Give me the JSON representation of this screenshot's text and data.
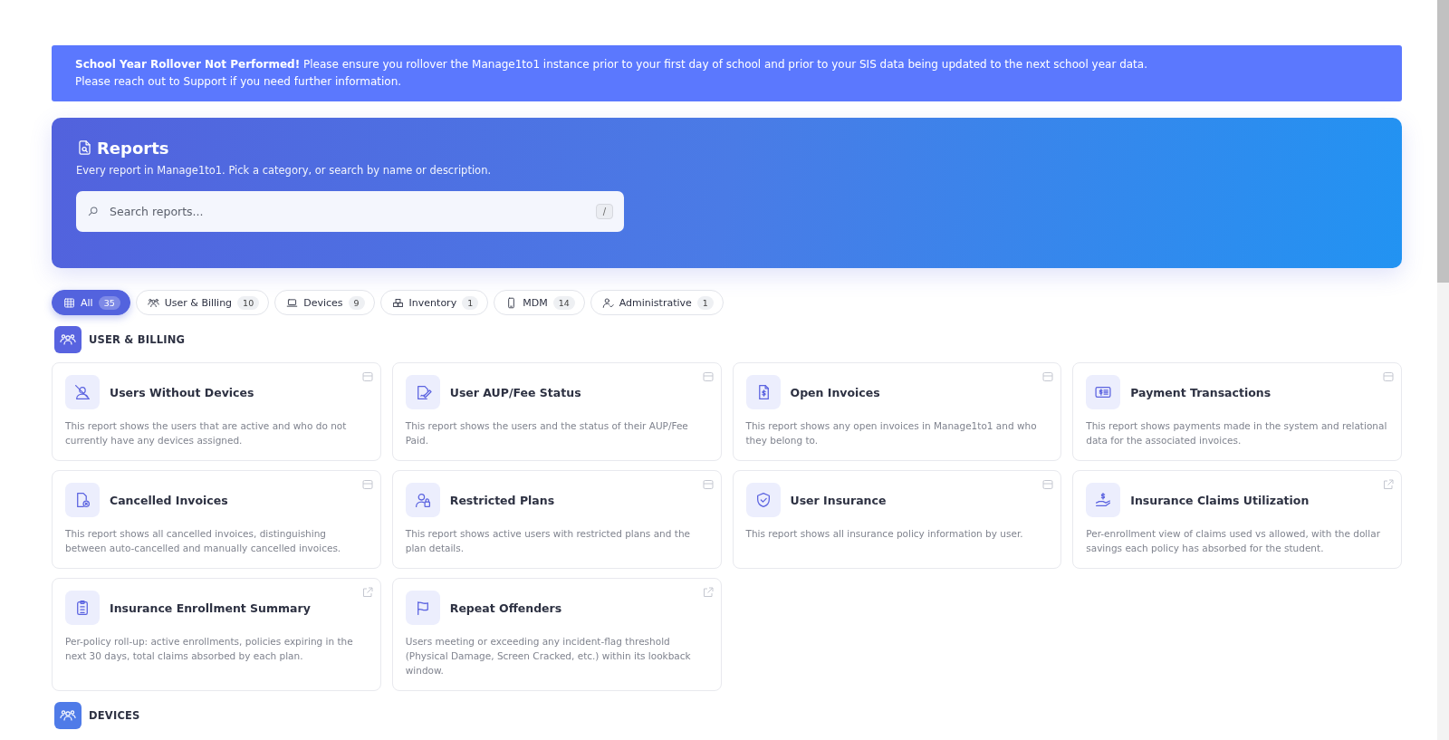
{
  "banner": {
    "lines": [
      "**School Year Rollover Not Performed!** Please ensure you rollover the Manage1to1 instance prior to your first day of school and prior to your SIS data being updated to the next school year data.",
      "Please reach out to Support if you need further information."
    ]
  },
  "hero": {
    "title": "Reports",
    "subtitle": "Every report in Manage1to1. Pick a category, or search by name or description.",
    "search": {
      "placeholder": "Search reports...",
      "shortcut": "/"
    }
  },
  "filters": [
    {
      "label": "All",
      "count": "35",
      "selected": true
    },
    {
      "label": "User & Billing",
      "count": "10",
      "selected": false
    },
    {
      "label": "Devices",
      "count": "9",
      "selected": false
    },
    {
      "label": "Inventory",
      "count": "1",
      "selected": false
    },
    {
      "label": "MDM",
      "count": "14",
      "selected": false
    },
    {
      "label": "Administrative",
      "count": "1",
      "selected": false
    }
  ],
  "sections": [
    {
      "title": "USER & BILLING",
      "reports": [
        {
          "title": "Users Without Devices",
          "description": "This report shows the users that are active and who do not currently have any devices assigned.",
          "kind": "inline"
        },
        {
          "title": "User AUP/Fee Status",
          "description": "This report shows the users and the status of their AUP/Fee Paid.",
          "kind": "inline"
        },
        {
          "title": "Open Invoices",
          "description": "This report shows any open invoices in Manage1to1 and who they belong to.",
          "kind": "inline"
        },
        {
          "title": "Payment Transactions",
          "description": "This report shows payments made in the system and relational data for the associated invoices.",
          "kind": "inline"
        },
        {
          "title": "Cancelled Invoices",
          "description": "This report shows all cancelled invoices, distinguishing between auto-cancelled and manually cancelled invoices.",
          "kind": "inline"
        },
        {
          "title": "Restricted Plans",
          "description": "This report shows active users with restricted plans and the plan details.",
          "kind": "inline"
        },
        {
          "title": "User Insurance",
          "description": "This report shows all insurance policy information by user.",
          "kind": "inline"
        },
        {
          "title": "Insurance Claims Utilization",
          "description": "Per-enrollment view of claims used vs allowed, with the dollar savings each policy has absorbed for the student.",
          "kind": "external"
        },
        {
          "title": "Insurance Enrollment Summary",
          "description": "Per-policy roll-up: active enrollments, policies expiring in the next 30 days, total claims absorbed by each plan.",
          "kind": "external"
        },
        {
          "title": "Repeat Offenders",
          "description": "Users meeting or exceeding any incident-flag threshold (Physical Damage, Screen Cracked, etc.) within its lookback window.",
          "kind": "external"
        }
      ]
    },
    {
      "title": "DEVICES"
    }
  ]
}
